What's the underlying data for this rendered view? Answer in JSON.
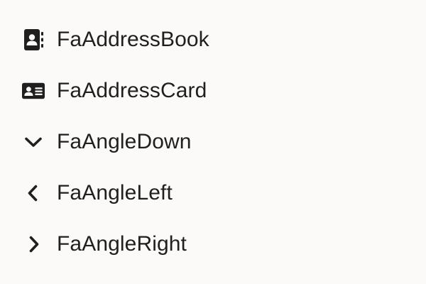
{
  "items": [
    {
      "icon": "address-book-icon",
      "label": "FaAddressBook"
    },
    {
      "icon": "address-card-icon",
      "label": "FaAddressCard"
    },
    {
      "icon": "angle-down-icon",
      "label": "FaAngleDown"
    },
    {
      "icon": "angle-left-icon",
      "label": "FaAngleLeft"
    },
    {
      "icon": "angle-right-icon",
      "label": "FaAngleRight"
    }
  ],
  "colors": {
    "background": "#fbfaf8",
    "text": "#1f1f1f",
    "icon": "#1f1f1f"
  }
}
